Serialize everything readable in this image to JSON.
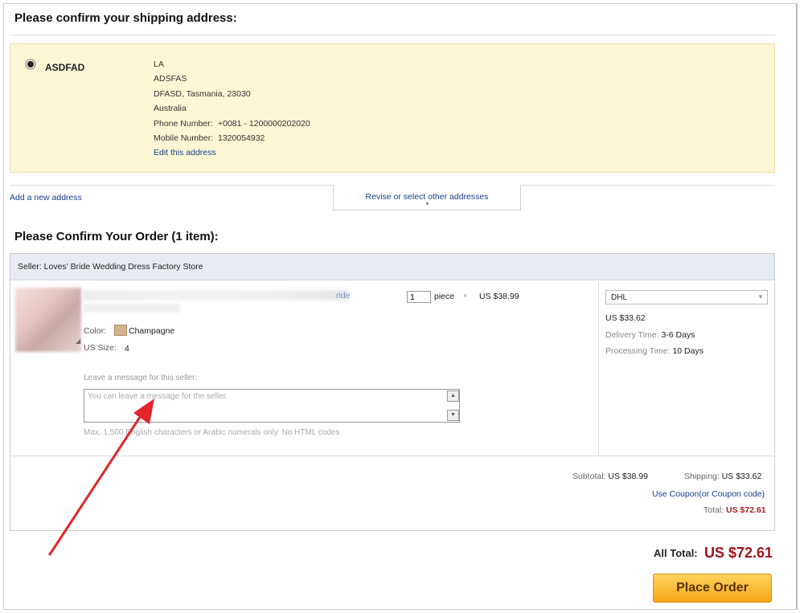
{
  "shipping": {
    "heading": "Please confirm your shipping address:",
    "address": {
      "name": "ASDFAD",
      "line1": "LA",
      "line2": "ADSFAS",
      "line3": "DFASD, Tasmania, 23030",
      "country": "Australia",
      "phone_label": "Phone Number:",
      "phone": "+0081 - 1200000202020",
      "mobile_label": "Mobile Number:",
      "mobile": "1320054932",
      "edit_link": "Edit this address"
    },
    "add_new_link": "Add a new address",
    "revise_link": "Revise or select other addresses"
  },
  "order": {
    "heading": "Please Confirm Your Order (1 item):",
    "seller": "Seller: Loves' Bride Wedding Dress Factory Store",
    "item": {
      "title_suffix": "ride",
      "color_label": "Color:",
      "color_value": "Champagne",
      "size_label": "US Size:",
      "size_value": "4",
      "quantity": "1",
      "unit": "piece",
      "times": "×",
      "price": "US $38.99"
    },
    "message": {
      "label": "Leave a message for this seller:",
      "placeholder": "You can leave a message for the seller.",
      "hint": "Max. 1,500 English characters or Arabic numerals only. No HTML codes"
    },
    "shipping_method": {
      "selected": "DHL",
      "cost": "US $33.62",
      "delivery_label": "Delivery Time:",
      "delivery_value": "3-6 Days",
      "processing_label": "Processing Time:",
      "processing_value": "10 Days"
    },
    "summary": {
      "subtotal_label": "Subtotal:",
      "subtotal_value": "US $38.99",
      "shipping_label": "Shipping:",
      "shipping_value": "US $33.62",
      "coupon_link": "Use Coupon(or Coupon code)",
      "total_label": "Total:",
      "total_value": "US $72.61"
    }
  },
  "footer": {
    "all_total_label": "All Total:",
    "all_total_value": "US $72.61",
    "place_order_label": "Place Order"
  },
  "colors": {
    "address_bg": "#fbf7d4",
    "seller_bar_bg": "#e7ebf2",
    "link": "#1a3d8c",
    "total_red": "#a0141a",
    "button_orange": "#f7a719",
    "annotation_arrow": "#e3262b"
  }
}
